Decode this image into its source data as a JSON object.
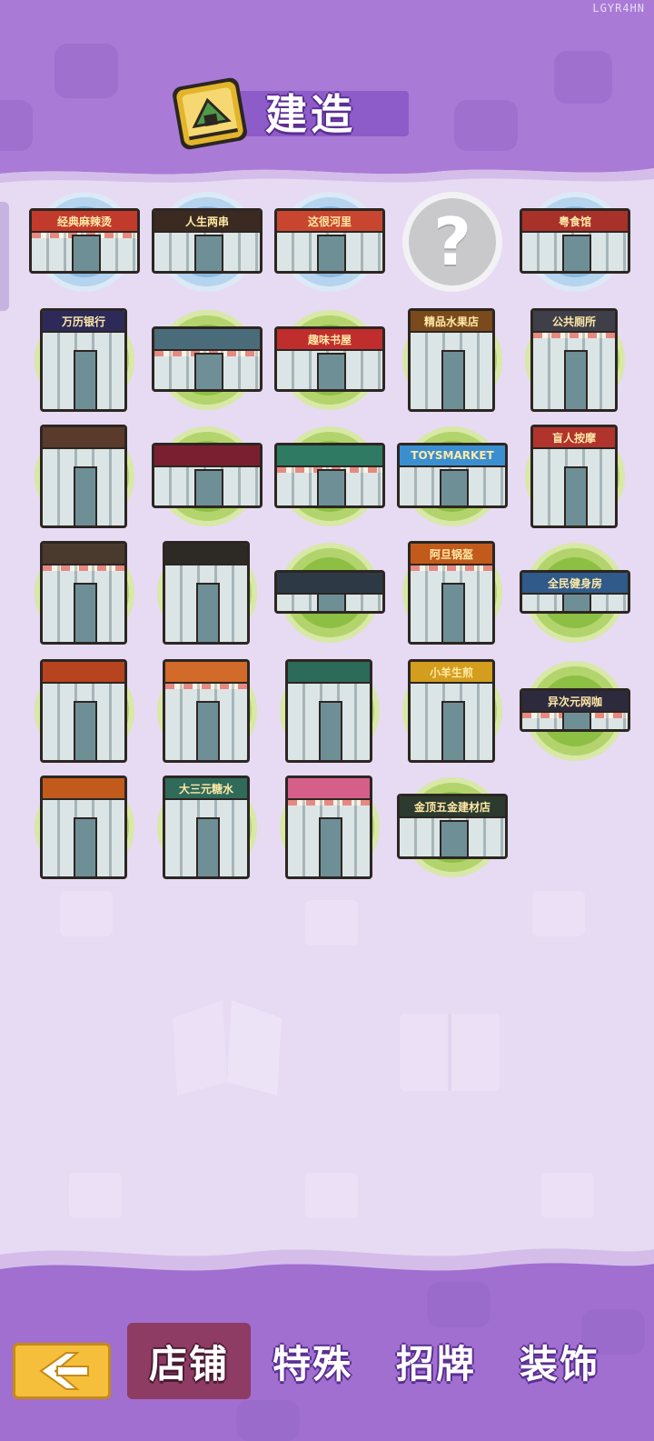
{
  "watermark": "LGYR4HN",
  "header": {
    "title": "建造",
    "icon": "building-blueprint-icon"
  },
  "colors": {
    "background": "#a97bd6",
    "panel": "#e7daf3",
    "circle_blue": "#89b9e3",
    "circle_green": "#8ebf45",
    "circle_locked": "#c9c9cb",
    "active_tab": "#8e3c63",
    "back_button": "#f5bf3c"
  },
  "shops": [
    {
      "sign": "经典麻辣烫",
      "ring": "blue",
      "shape": "wide",
      "sign_color": "#c23a2c"
    },
    {
      "sign": "人生两串",
      "ring": "blue",
      "shape": "wide",
      "sign_color": "#3b2a21"
    },
    {
      "sign": "这很河里",
      "ring": "blue",
      "shape": "wide",
      "sign_color": "#c8462f"
    },
    {
      "sign": "?",
      "ring": "locked",
      "shape": "none",
      "sign_color": ""
    },
    {
      "sign": "粤食馆",
      "ring": "blue",
      "shape": "wide",
      "sign_color": "#a8322a"
    },
    {
      "sign": "万历银行",
      "ring": "green",
      "shape": "tall",
      "sign_color": "#2d2a5a"
    },
    {
      "sign": "",
      "ring": "green",
      "shape": "wide",
      "sign_color": "#4a6b7a"
    },
    {
      "sign": "趣味书屋",
      "ring": "green",
      "shape": "wide",
      "sign_color": "#c02d2d"
    },
    {
      "sign": "精品水果店",
      "ring": "green",
      "shape": "tall",
      "sign_color": "#7a4a1c"
    },
    {
      "sign": "公共厕所",
      "ring": "green",
      "shape": "tall",
      "sign_color": "#3f3f4a"
    },
    {
      "sign": "",
      "ring": "green",
      "shape": "tall",
      "sign_color": "#5a3a2a"
    },
    {
      "sign": "",
      "ring": "green",
      "shape": "wide",
      "sign_color": "#7a1f2f"
    },
    {
      "sign": "",
      "ring": "green",
      "shape": "wide",
      "sign_color": "#2f7a62"
    },
    {
      "sign": "TOYSMARKET",
      "ring": "green",
      "shape": "wide",
      "sign_color": "#3a8fd1"
    },
    {
      "sign": "盲人按摩",
      "ring": "green",
      "shape": "tall",
      "sign_color": "#b1332d"
    },
    {
      "sign": "",
      "ring": "green",
      "shape": "tall",
      "sign_color": "#4a3a2e"
    },
    {
      "sign": "",
      "ring": "green",
      "shape": "tall",
      "sign_color": "#2d2a26"
    },
    {
      "sign": "",
      "ring": "green",
      "shape": "strip",
      "sign_color": "#2d3a46"
    },
    {
      "sign": "阿旦锅盔",
      "ring": "green",
      "shape": "tall",
      "sign_color": "#c25a1c"
    },
    {
      "sign": "全民健身房",
      "ring": "green",
      "shape": "strip",
      "sign_color": "#2f5a8a"
    },
    {
      "sign": "",
      "ring": "green",
      "shape": "tall",
      "sign_color": "#b8431f"
    },
    {
      "sign": "",
      "ring": "green",
      "shape": "tall",
      "sign_color": "#d26a2a"
    },
    {
      "sign": "",
      "ring": "green",
      "shape": "tall",
      "sign_color": "#2c6a5a"
    },
    {
      "sign": "小羊生煎",
      "ring": "green",
      "shape": "tall",
      "sign_color": "#d39d1d"
    },
    {
      "sign": "异次元网咖",
      "ring": "green",
      "shape": "strip",
      "sign_color": "#2d2a3e"
    },
    {
      "sign": "",
      "ring": "green",
      "shape": "tall",
      "sign_color": "#c25a1c"
    },
    {
      "sign": "大三元糖水",
      "ring": "green",
      "shape": "tall",
      "sign_color": "#2f6a5a"
    },
    {
      "sign": "",
      "ring": "green",
      "shape": "tall",
      "sign_color": "#d65f8a"
    },
    {
      "sign": "金顶五金建材店",
      "ring": "green",
      "shape": "wide",
      "sign_color": "#2d3a2e"
    }
  ],
  "nav": {
    "back_icon": "chevron-left-icon",
    "tabs": [
      {
        "label": "店铺",
        "active": true
      },
      {
        "label": "特殊",
        "active": false
      },
      {
        "label": "招牌",
        "active": false
      },
      {
        "label": "装饰",
        "active": false
      }
    ]
  }
}
